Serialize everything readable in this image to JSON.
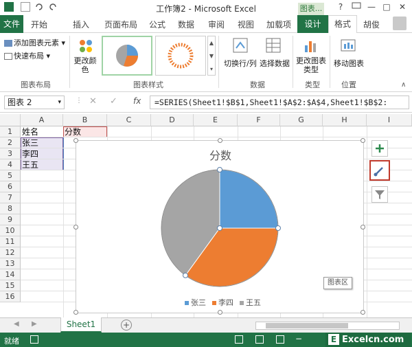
{
  "app": {
    "window_title": "工作簿2 - Microsoft Excel",
    "chart_tools_label": "图表...",
    "window_controls": [
      "?",
      "—",
      "□",
      "✕"
    ]
  },
  "tabs": {
    "file": "文件",
    "items": [
      "开始",
      "插入",
      "页面布局",
      "公式",
      "数据",
      "审阅",
      "视图",
      "加载项"
    ],
    "design": "设计",
    "format": "格式",
    "user": "胡俊"
  },
  "ribbon": {
    "chart_layout": {
      "add_element": "添加图表元素",
      "quick_layout": "快速布局",
      "label": "图表布局"
    },
    "change_colors": "更改颜色",
    "chart_styles_label": "图表样式",
    "data": {
      "switch_row_col": "切换行/列",
      "select_data": "选择数据",
      "label": "数据"
    },
    "type": {
      "change_type": "更改图表类型",
      "label": "类型"
    },
    "location": {
      "move_chart": "移动图表",
      "label": "位置"
    }
  },
  "formula_bar": {
    "name_box": "图表 2",
    "formula": "=SERIES(Sheet1!$B$1,Sheet1!$A$2:$A$4,Sheet1!$B$2:",
    "fx": "fx"
  },
  "grid": {
    "columns": [
      "A",
      "B",
      "C",
      "D",
      "E",
      "F",
      "G",
      "H",
      "I"
    ],
    "rows": [
      "1",
      "2",
      "3",
      "4",
      "5",
      "6",
      "7",
      "8",
      "9",
      "10",
      "11",
      "12",
      "13",
      "14",
      "15",
      "16"
    ],
    "cells": {
      "A1": "姓名",
      "B1": "分数",
      "A2": "张三",
      "A3": "李四",
      "A4": "王五"
    }
  },
  "chart_data": {
    "type": "pie",
    "title": "分数",
    "categories": [
      "张三",
      "李四",
      "王五"
    ],
    "values": [
      25,
      35,
      40
    ],
    "colors": [
      "#5b9bd5",
      "#ed7d31",
      "#a5a5a5"
    ],
    "legend_position": "bottom",
    "chart_area_tooltip": "图表区"
  },
  "sheets": {
    "tabs": [
      "Sheet1"
    ],
    "add_sheet": "+"
  },
  "status": {
    "ready": "就绪",
    "watermark": "Excelcn.com"
  },
  "colors": {
    "excel_green": "#217346",
    "highlight_red": "#c0392b"
  }
}
